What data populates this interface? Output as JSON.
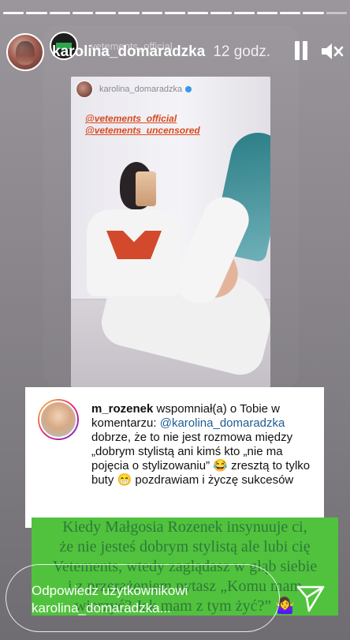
{
  "story": {
    "progress_segments": 15,
    "progress_completed": 14
  },
  "header": {
    "username": "karolina_domaradzka",
    "time": "12 godz.",
    "pause_icon": "pause-icon",
    "mute_icon": "speaker-muted-icon"
  },
  "shared_story": {
    "account": "vetements_official"
  },
  "photo": {
    "username": "karolina_domaradzka",
    "tags": [
      "@vetements_official",
      "@vetements_uncensored"
    ]
  },
  "comment": {
    "username": "m_rozenek",
    "intro": "wspomniał(a) o Tobie w komentarzu:",
    "mention": "@karolina_domaradzka",
    "body": "dobrze, że to nie jest rozmowa między „dobrym stylistą ani kimś  kto „nie ma pojęcia o stylizowaniu” 😂 zresztą to tylko buty 😁 pozdrawiam i życzę sukcesów"
  },
  "caption": {
    "lines": [
      "Kiedy Małgosia Rozenek insynuuje ci,",
      "że nie jesteś dobrym stylistą ale lubi cię",
      "Vetements, wtedy zaglądasz w głąb siebie",
      "i z przerażeniem pytasz „Komu mam",
      "wierzyć? Jak mam z tym żyć?” 🤷‍♀️"
    ]
  },
  "reply": {
    "placeholder_line1": "Odpowiedz użytkownikowi",
    "placeholder_line2": "karolina_domaradzka...",
    "send_icon": "send-icon"
  },
  "colors": {
    "caption_bg": "#51c23d",
    "tag_color": "#d94a1f",
    "mention_color": "#1d5c95"
  }
}
